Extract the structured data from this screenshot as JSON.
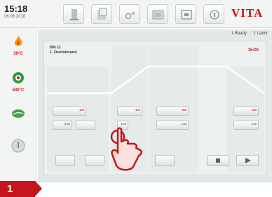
{
  "header": {
    "time": "15:18",
    "date": "06.06.2018",
    "brand": "VITA",
    "tool_icons": [
      "furnace-icon",
      "program-list-icon",
      "firing-tray-icon",
      "gallery-icon",
      "media-icon",
      "help-icon"
    ]
  },
  "sidebar": {
    "items": [
      {
        "icon": "flame-icon",
        "label": "39°C"
      },
      {
        "icon": "vacuum-pump-icon",
        "label": "500°C"
      },
      {
        "icon": "leaf-icon",
        "label": ""
      },
      {
        "icon": "power-icon",
        "label": ""
      }
    ]
  },
  "status": {
    "ready": "1 Ready",
    "user": "1 Labor"
  },
  "program": {
    "line1": "BM 11",
    "line2": "1. Dentinbrand",
    "timer": "15:00"
  },
  "buttons": {
    "a1": "400",
    "a2": "6:00",
    "b1": "920",
    "b2": "1:00",
    "c1": "930",
    "c2": "1:00",
    "d1": "920",
    "d2": "1:00",
    "e1": "",
    "e2": ""
  },
  "step_badge": "1",
  "colors": {
    "accent": "#c4161c",
    "panel": "#eef1f1",
    "curve": "#ffffff"
  }
}
